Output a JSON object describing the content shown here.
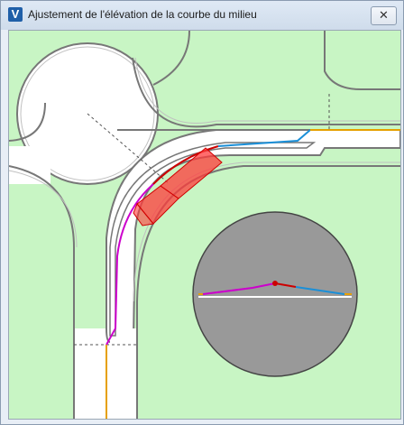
{
  "window": {
    "app_icon_letter": "V",
    "app_icon_name": "vectorworks-logo",
    "title": "Ajustement de l'élévation de la courbe du milieu",
    "close_glyph": "✕"
  },
  "colors": {
    "grass": "#c8f5c4",
    "road": "#ffffff",
    "road_edge": "#777777",
    "profile_left": "#cc00cc",
    "profile_mid": "#cc0000",
    "profile_right": "#1a8fd8",
    "tie_line": "#e6a000",
    "selection_fill": "#ff3b3b",
    "elevation_disc": "#999999"
  }
}
